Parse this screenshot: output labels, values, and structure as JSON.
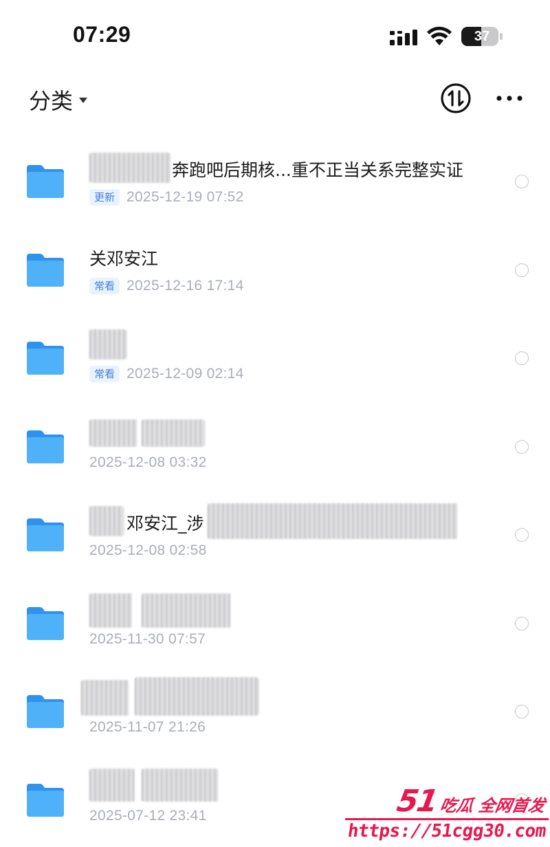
{
  "status_bar": {
    "time": "07:29",
    "battery_level": "37"
  },
  "header": {
    "category_label": "分类",
    "icons": {
      "caret": "caret-down-icon",
      "sort": "sort-icon",
      "more": "more-icon"
    }
  },
  "colors": {
    "folder_blue": "#3aa0f3",
    "badge_text": "#3d7fd8",
    "badge_bg": "#eaf3fd",
    "date_gray": "#a9aeb6",
    "watermark_red": "#e8174e"
  },
  "files": [
    {
      "name": "奔跑吧后期核...重不正当关系完整实证",
      "badge": "更新",
      "date": "2025-12-19 07:52"
    },
    {
      "name": "关邓安江",
      "badge": "常看",
      "date": "2025-12-16 17:14"
    },
    {
      "name": "",
      "badge": "常看",
      "date": "2025-12-09 02:14"
    },
    {
      "name": "",
      "badge": "",
      "date": "2025-12-08 03:32"
    },
    {
      "name": "邓安江_涉",
      "badge": "",
      "date": "2025-12-08 02:58"
    },
    {
      "name": "",
      "badge": "",
      "date": "2025-11-30 07:57"
    },
    {
      "name": "",
      "badge": "",
      "date": "2025-11-07 21:26"
    },
    {
      "name": "",
      "badge": "",
      "date": "2025-07-12 23:41"
    }
  ],
  "watermark": {
    "logo_number": "51",
    "logo_text": "吃瓜 全网首发",
    "url": "https://51cgg30.com"
  }
}
